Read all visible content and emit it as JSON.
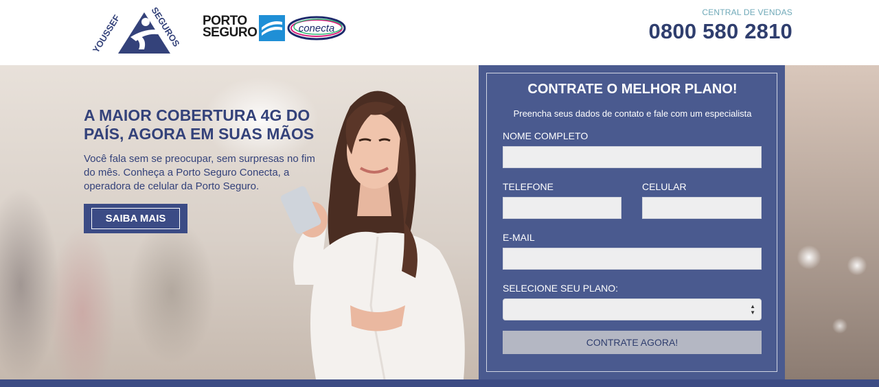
{
  "header": {
    "logo_youssef_text": "YOUSSEF SEGUROS",
    "logo_porto_line1": "PORTO",
    "logo_porto_line2": "SEGURO",
    "logo_conecta_text": "conecta",
    "central_label": "CENTRAL DE VENDAS",
    "phone": "0800 580 2810"
  },
  "hero": {
    "title": "A MAIOR COBERTURA 4G DO PAÍS, AGORA EM SUAS MÃOS",
    "text": "Você fala sem se preocupar, sem surpresas no fim do mês. Conheça a Porto Seguro Conecta, a operadora de celular da Porto Seguro.",
    "button_label": "SAIBA MAIS"
  },
  "form": {
    "title": "CONTRATE O MELHOR PLANO!",
    "subtitle": "Preencha seus dados de contato e fale com um especialista",
    "name_label": "NOME COMPLETO",
    "name_value": "",
    "phone_label": "TELEFONE",
    "phone_value": "",
    "cell_label": "CELULAR",
    "cell_value": "",
    "email_label": "E-MAIL",
    "email_value": "",
    "plan_label": "SELECIONE SEU PLANO:",
    "plan_value": "",
    "submit_label": "CONTRATE AGORA!"
  },
  "colors": {
    "brand_navy": "#34427a",
    "form_bg": "#4a5a8f",
    "accent_teal": "#6fa9b8"
  }
}
